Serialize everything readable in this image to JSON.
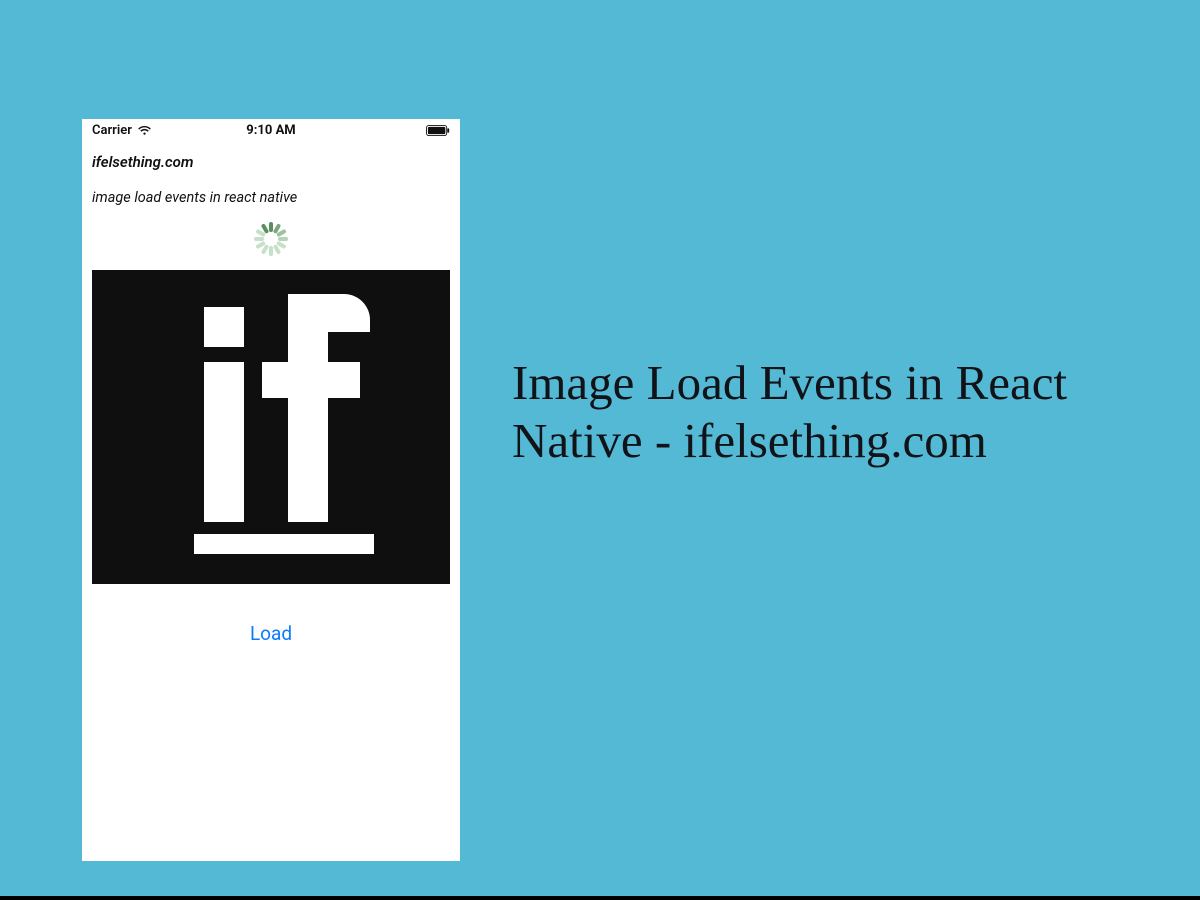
{
  "background_color": "#54b9d4",
  "headline": "Image Load Events in React Native - ifelsething.com",
  "phone": {
    "status": {
      "carrier": "Carrier",
      "time": "9:10 AM"
    },
    "site_label": "ifelsething.com",
    "subtitle": "image load events in react native",
    "spinner_color_active": "#5a8e5f",
    "spinner_color_idle": "#c7e0c9",
    "image_tile": {
      "bg": "#0f0f0f",
      "logo_text": "if"
    },
    "load_button": "Load"
  }
}
